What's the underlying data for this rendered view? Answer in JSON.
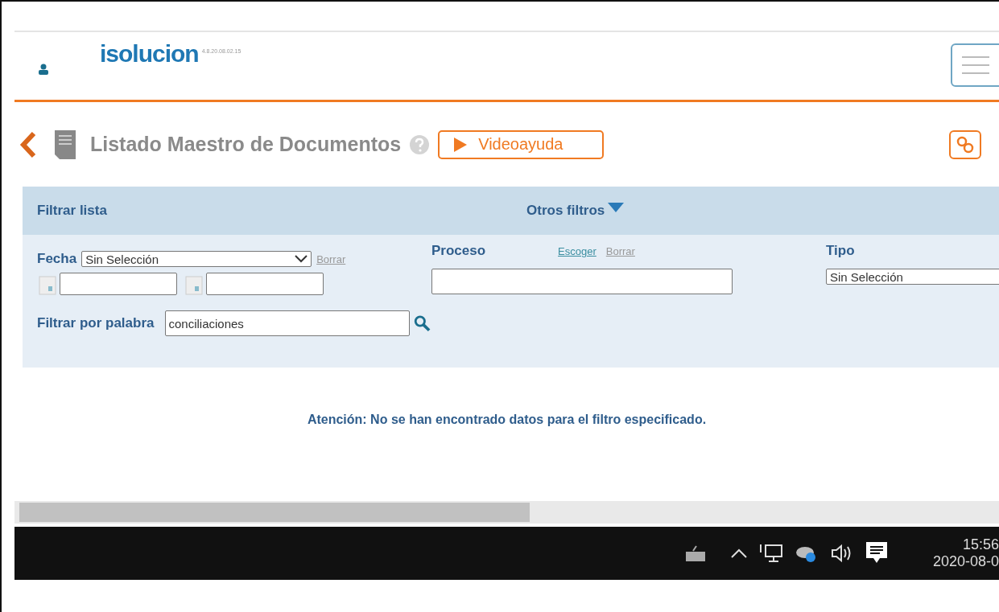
{
  "header": {
    "logo": "isolucion",
    "version": "4.8.20.08.02.15"
  },
  "page": {
    "title": "Listado Maestro de Documentos",
    "video_button": "Videoayuda"
  },
  "filters": {
    "title": "Filtrar lista",
    "other_filters": "Otros filtros",
    "fecha": {
      "label": "Fecha",
      "value": "Sin Selección",
      "clear": "Borrar"
    },
    "proceso": {
      "label": "Proceso",
      "choose": "Escoger",
      "clear": "Borrar"
    },
    "tipo": {
      "label": "Tipo",
      "value": "Sin Selección"
    },
    "keyword": {
      "label": "Filtrar por palabra",
      "value": "conciliaciones"
    }
  },
  "message": "Atención: No se han encontrado datos para el filtro especificado.",
  "taskbar": {
    "time": "15:56",
    "date": "2020-08-0"
  }
}
